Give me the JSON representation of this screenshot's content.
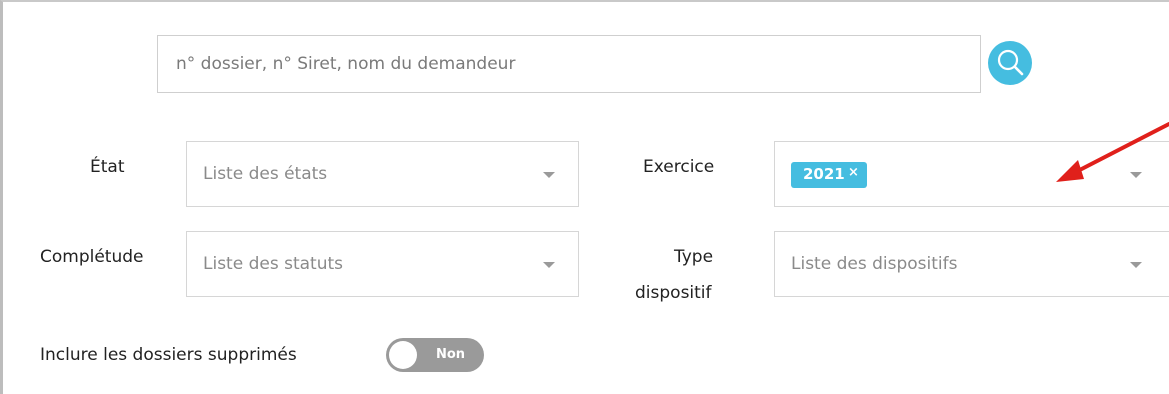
{
  "search": {
    "placeholder": "n° dossier, n° Siret, nom du demandeur",
    "button_icon": "search-icon",
    "accent_color": "#45bde0"
  },
  "filters": {
    "etat": {
      "label": "État",
      "placeholder": "Liste des états"
    },
    "exercice": {
      "label": "Exercice",
      "tags": [
        {
          "label": "2021",
          "remove": "×"
        }
      ]
    },
    "completude": {
      "label": "Complétude",
      "placeholder": "Liste des statuts"
    },
    "type_dispositif": {
      "label_line1": "Type",
      "label_line2": "dispositif",
      "placeholder": "Liste des dispositifs"
    }
  },
  "include_deleted": {
    "label": "Inclure les dossiers supprimés",
    "toggle_text": "Non",
    "enabled": false
  },
  "annotation": {
    "icon": "red-arrow-icon",
    "color": "#e0201b"
  }
}
